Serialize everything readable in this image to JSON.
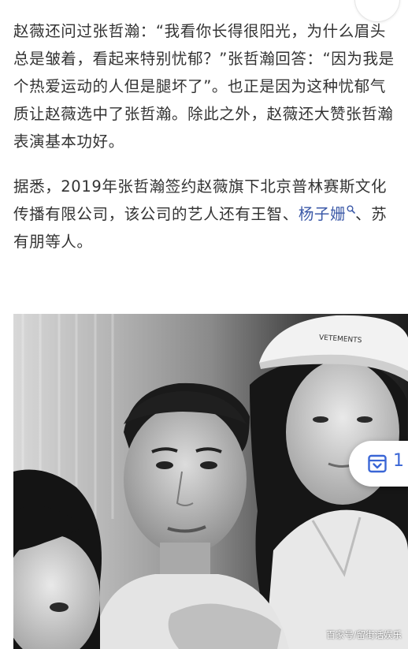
{
  "article": {
    "paragraph_1": "赵薇还问过张哲瀚：“我看你长得很阳光，为什么眉头总是皱着，看起来特别忧郁？”张哲瀚回答：“因为我是个热爱运动的人但是腿坏了”。也正是因为这种忧郁气质让赵薇选中了张哲瀚。除此之外，赵薇还大赞张哲瀚表演基本功好。",
    "paragraph_2_before_link": "据悉，2019年张哲瀚签约赵薇旗下北京普林赛斯文化传播有限公司，该公司的艺人还有王智、",
    "paragraph_2_link": "杨子姗",
    "paragraph_2_after_link": "、苏有朋等人。"
  },
  "photo": {
    "cap_text": "VETEMENTS"
  },
  "collect": {
    "icon": "collect-box-icon",
    "count": "1"
  },
  "watermark": "百家号/留街话娱乐",
  "colors": {
    "text": "#333333",
    "link": "#3c5aa8",
    "accent": "#3a66d6"
  }
}
